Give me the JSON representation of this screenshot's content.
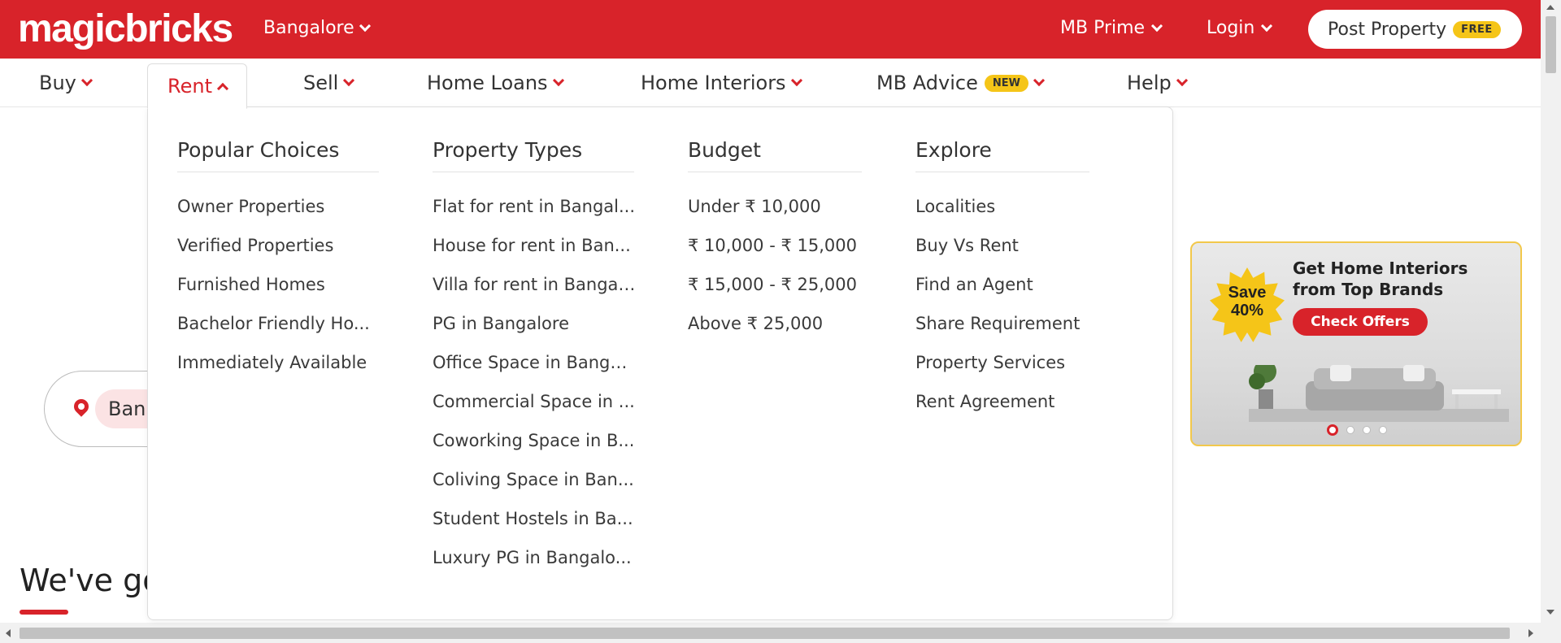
{
  "header": {
    "logo": "magicbricks",
    "city": "Bangalore",
    "mb_prime": "MB Prime",
    "login": "Login",
    "post_property": "Post Property",
    "free_badge": "FREE"
  },
  "nav": {
    "buy": "Buy",
    "rent": "Rent",
    "sell": "Sell",
    "home_loans": "Home Loans",
    "home_interiors": "Home Interiors",
    "mb_advice": "MB Advice",
    "new_badge": "NEW",
    "help": "Help"
  },
  "dropdown": {
    "popular": {
      "title": "Popular Choices",
      "items": [
        "Owner Properties",
        "Verified Properties",
        "Furnished Homes",
        "Bachelor Friendly Ho...",
        "Immediately Available"
      ]
    },
    "property_types": {
      "title": "Property Types",
      "items": [
        "Flat for rent in Bangal...",
        "House for rent in Ban...",
        "Villa for rent in Bangal...",
        "PG in Bangalore",
        "Office Space in Banga...",
        "Commercial Space in ...",
        "Coworking Space in B...",
        "Coliving Space in Ban...",
        "Student Hostels in Ba...",
        "Luxury PG in Bangalo..."
      ]
    },
    "budget": {
      "title": "Budget",
      "items": [
        "Under ₹ 10,000",
        "₹ 10,000 - ₹ 15,000",
        "₹ 15,000 - ₹ 25,000",
        "Above ₹ 25,000"
      ]
    },
    "explore": {
      "title": "Explore",
      "items": [
        "Localities",
        "Buy Vs Rent",
        "Find an Agent",
        "Share Requirement",
        "Property Services",
        "Rent Agreement"
      ]
    }
  },
  "promo": {
    "save_line1": "Save",
    "save_line2": "40%",
    "title": "Get Home Interiors from Top Brands",
    "cta": "Check Offers"
  },
  "page": {
    "city_chip": "Ban",
    "heading": "We've go"
  },
  "colors": {
    "brand_red": "#d8232a",
    "badge_yellow": "#f5c518"
  }
}
